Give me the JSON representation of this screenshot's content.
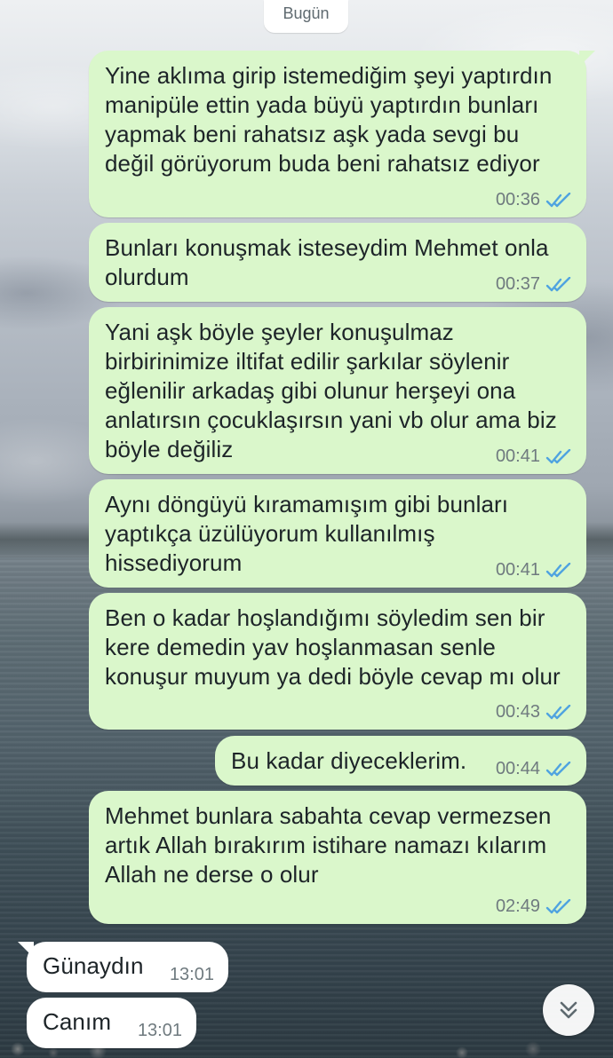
{
  "date_chip": "Bugün",
  "messages": [
    {
      "text": "Yine aklıma girip istemediğim şeyi yaptırdın manipüle ettin yada büyü yaptırdın bunları yapmak beni rahatsız aşk yada sevgi bu değil görüyorum buda beni rahatsız ediyor",
      "time": "00:36"
    },
    {
      "text": "Bunları konuşmak isteseydim Mehmet onla olurdum",
      "time": "00:37"
    },
    {
      "text": "Yani aşk böyle şeyler konuşulmaz birbirinimize iltifat edilir şarkılar söylenir eğlenilir arkadaş gibi olunur herşeyi ona anlatırsın çocuklaşırsın yani vb olur ama biz böyle değiliz",
      "time": "00:41"
    },
    {
      "text": "Aynı döngüyü kıramamışım gibi bunları yaptıkça üzülüyorum kullanılmış hissediyorum",
      "time": "00:41"
    },
    {
      "text": "Ben o kadar hoşlandığımı söyledim sen bir kere demedin yav hoşlanmasan senle konuşur muyum ya dedi böyle cevap mı olur",
      "time": "00:43"
    },
    {
      "text": "Bu kadar diyeceklerim.",
      "time": "00:44"
    },
    {
      "text": "Mehmet bunlara sabahta cevap vermezsen artık Allah bırakırım istihare namazı kılarım Allah ne derse o olur",
      "time": "02:49"
    },
    {
      "text": "Günaydın",
      "time": "13:01"
    },
    {
      "text": "Canım",
      "time": "13:01"
    }
  ],
  "colors": {
    "outgoing_bubble": "#daf7cb",
    "incoming_bubble": "#ffffff",
    "read_ticks": "#4fa3e0"
  },
  "icons": {
    "read_receipt": "double-check-icon",
    "scroll_down": "double-chevron-down-icon"
  }
}
